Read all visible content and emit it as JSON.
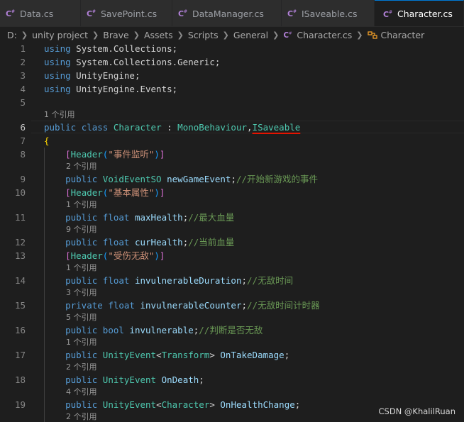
{
  "tabs": [
    {
      "label": "Data.cs",
      "icon": "csharp-file-icon"
    },
    {
      "label": "SavePoint.cs",
      "icon": "csharp-file-icon"
    },
    {
      "label": "DataManager.cs",
      "icon": "csharp-file-icon"
    },
    {
      "label": "ISaveable.cs",
      "icon": "csharp-file-icon"
    },
    {
      "label": "Character.cs",
      "icon": "csharp-file-icon",
      "active": true
    }
  ],
  "breadcrumb": {
    "parts": [
      "D:",
      "unity project",
      "Brave",
      "Assets",
      "Scripts",
      "General"
    ],
    "file": "Character.cs",
    "symbol": "Character"
  },
  "editor": {
    "line_numbers": [
      "1",
      "2",
      "3",
      "4",
      "5",
      "6",
      "7",
      "8",
      "9",
      "10",
      "11",
      "12",
      "13",
      "14",
      "15",
      "16",
      "17",
      "18",
      "19"
    ],
    "active_line": "6",
    "code": {
      "l1_using": "using",
      "l1_ns": "System.Collections",
      "l2_using": "using",
      "l2_ns": "System.Collections.Generic",
      "l3_using": "using",
      "l3_ns": "UnityEngine",
      "l4_using": "using",
      "l4_ns": "UnityEngine.Events",
      "l6_public": "public",
      "l6_class": "class",
      "l6_name": "Character",
      "l6_colon": " : ",
      "l6_base": "MonoBehaviour",
      "l6_comma": ",",
      "l6_iface": "ISaveable",
      "l7_brace": "{",
      "l8_attr": "Header",
      "l8_str": "\"事件监听\"",
      "l9_public": "public",
      "l9_type": "VoidEventSO",
      "l9_name": "newGameEvent",
      "l9_cmt": "//开始新游戏的事件",
      "l10_attr": "Header",
      "l10_str": "\"基本属性\"",
      "l11_public": "public",
      "l11_type": "float",
      "l11_name": "maxHealth",
      "l11_cmt": "//最大血量",
      "l12_public": "public",
      "l12_type": "float",
      "l12_name": "curHealth",
      "l12_cmt": "//当前血量",
      "l13_attr": "Header",
      "l13_str": "\"受伤无敌\"",
      "l14_public": "public",
      "l14_type": "float",
      "l14_name": "invulnerableDuration",
      "l14_cmt": "//无敌时间",
      "l15_private": "private",
      "l15_type": "float",
      "l15_name": "invulnerableCounter",
      "l15_cmt": "//无敌时间计时器",
      "l16_public": "public",
      "l16_type": "bool",
      "l16_name": "invulnerable",
      "l16_cmt": "//判断是否无敌",
      "l17_public": "public",
      "l17_type": "UnityEvent",
      "l17_targ": "Transform",
      "l17_name": "OnTakeDamage",
      "l18_public": "public",
      "l18_type": "UnityEvent",
      "l18_name": "OnDeath",
      "l19_public": "public",
      "l19_type": "UnityEvent",
      "l19_targ": "Character",
      "l19_name": "OnHealthChange"
    },
    "codelens": {
      "class_refs": "1 个引用",
      "l9_refs": "2 个引用",
      "l11_refs": "1 个引用",
      "l12_refs": "9 个引用",
      "l14_refs": "1 个引用",
      "l15_refs": "3 个引用",
      "l16_refs": "5 个引用",
      "l17_refs": "1 个引用",
      "l18_refs": "2 个引用",
      "l19_refs": "4 个引用",
      "l20_refs": "2 个引用"
    }
  },
  "watermark": "CSDN @KhalilRuan",
  "colors": {
    "keyword": "#569cd6",
    "type": "#4ec9b0",
    "string": "#ce9178",
    "comment": "#6a9955",
    "error_squiggle": "#e51400"
  }
}
